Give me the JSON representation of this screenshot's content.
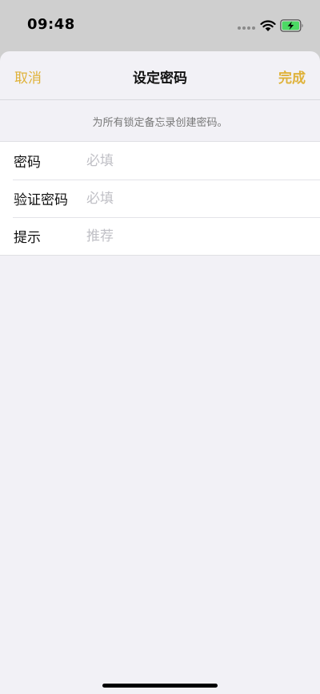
{
  "status_bar": {
    "time": "09:48"
  },
  "nav": {
    "cancel_label": "取消",
    "title": "设定密码",
    "done_label": "完成"
  },
  "note": "为所有锁定备忘录创建密码。",
  "form": {
    "rows": [
      {
        "label": "密码",
        "placeholder": "必填",
        "value": ""
      },
      {
        "label": "验证密码",
        "placeholder": "必填",
        "value": ""
      },
      {
        "label": "提示",
        "placeholder": "推荐",
        "value": ""
      }
    ]
  },
  "colors": {
    "accent": "#dfb23a",
    "sheet_background": "#f2f1f6",
    "status_background": "#cfcfcf",
    "battery_charge": "#4cd964"
  },
  "icons": [
    "signal-dots-icon",
    "wifi-icon",
    "battery-charging-icon"
  ]
}
